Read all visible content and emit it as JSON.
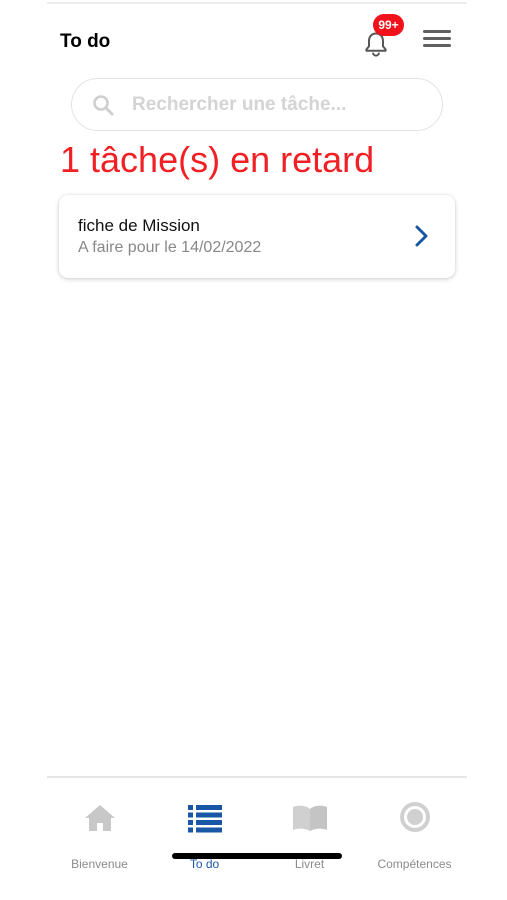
{
  "header": {
    "title": "To do",
    "notification_badge": "99+",
    "bell_icon": "bell-icon",
    "menu_icon": "hamburger-menu-icon"
  },
  "search": {
    "placeholder": "Rechercher une tâche...",
    "value": "",
    "icon": "search-icon"
  },
  "overdue": {
    "text": "1 tâche(s) en retard",
    "color": "#f21f24"
  },
  "tasks": [
    {
      "title": "fiche de Mission",
      "subtitle": "A faire pour le 14/02/2022",
      "icon": "chevron-right-icon"
    }
  ],
  "tabs": [
    {
      "label": "Bienvenue",
      "icon": "home-icon",
      "active": false
    },
    {
      "label": "To do",
      "icon": "list-icon",
      "active": true
    },
    {
      "label": "Livret",
      "icon": "book-icon",
      "active": false
    },
    {
      "label": "Compétences",
      "icon": "target-icon",
      "active": false
    }
  ],
  "colors": {
    "accent": "#1957a6",
    "alert": "#f2121b",
    "inactive": "#c8c8c8"
  }
}
